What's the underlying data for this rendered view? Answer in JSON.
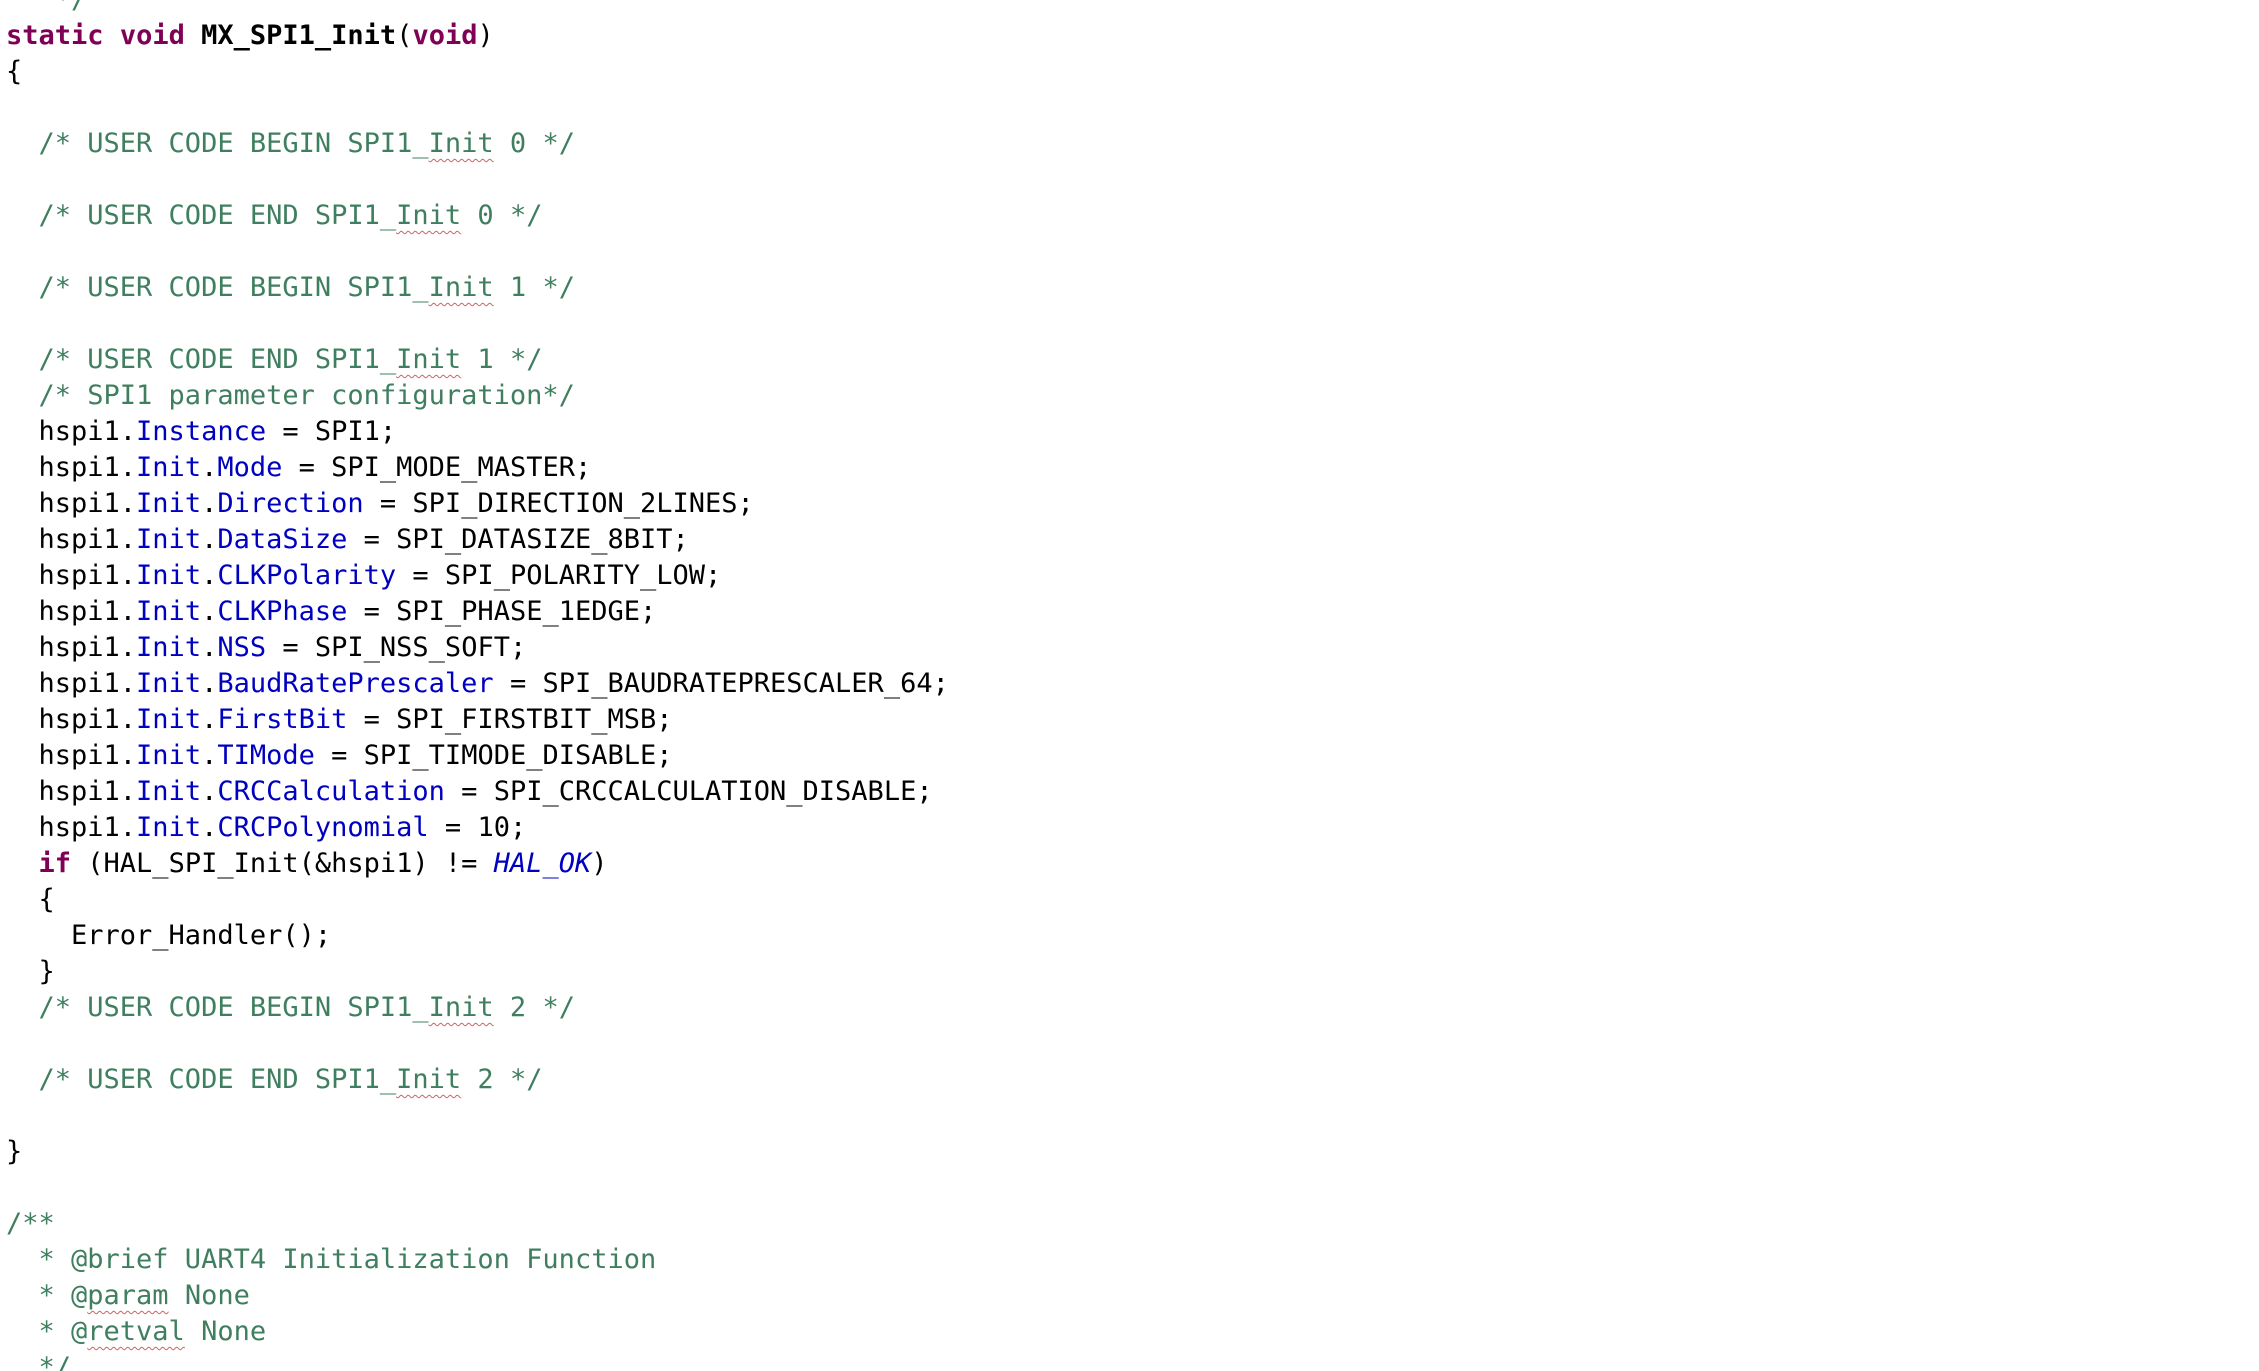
{
  "editor": {
    "lines": [
      {
        "segments": [
          {
            "t": "   */",
            "c": "cm"
          }
        ]
      },
      {
        "segments": [
          {
            "t": "static",
            "c": "kw"
          },
          {
            "t": " "
          },
          {
            "t": "void",
            "c": "kw"
          },
          {
            "t": " "
          },
          {
            "t": "MX_SPI1_Init",
            "c": "fn"
          },
          {
            "t": "("
          },
          {
            "t": "void",
            "c": "kw"
          },
          {
            "t": ")"
          }
        ]
      },
      {
        "segments": [
          {
            "t": "{"
          }
        ]
      },
      {
        "segments": []
      },
      {
        "segments": [
          {
            "t": "  /* USER CODE BEGIN SPI1_",
            "c": "cm"
          },
          {
            "t": "Init",
            "c": "cm sq"
          },
          {
            "t": " 0 */",
            "c": "cm"
          }
        ]
      },
      {
        "segments": []
      },
      {
        "segments": [
          {
            "t": "  /* USER CODE END SPI1_",
            "c": "cm"
          },
          {
            "t": "Init",
            "c": "cm sq"
          },
          {
            "t": " 0 */",
            "c": "cm"
          }
        ]
      },
      {
        "segments": []
      },
      {
        "segments": [
          {
            "t": "  /* USER CODE BEGIN SPI1_",
            "c": "cm"
          },
          {
            "t": "Init",
            "c": "cm sq"
          },
          {
            "t": " 1 */",
            "c": "cm"
          }
        ]
      },
      {
        "segments": []
      },
      {
        "segments": [
          {
            "t": "  /* USER CODE END SPI1_",
            "c": "cm"
          },
          {
            "t": "Init",
            "c": "cm sq"
          },
          {
            "t": " 1 */",
            "c": "cm"
          }
        ]
      },
      {
        "segments": [
          {
            "t": "  /* SPI1 parameter configuration*/",
            "c": "cm"
          }
        ]
      },
      {
        "segments": [
          {
            "t": "  hspi1."
          },
          {
            "t": "Instance",
            "c": "fld"
          },
          {
            "t": " = SPI1;"
          }
        ]
      },
      {
        "segments": [
          {
            "t": "  hspi1."
          },
          {
            "t": "Init",
            "c": "fld"
          },
          {
            "t": "."
          },
          {
            "t": "Mode",
            "c": "fld"
          },
          {
            "t": " = SPI_MODE_MASTER;"
          }
        ]
      },
      {
        "segments": [
          {
            "t": "  hspi1."
          },
          {
            "t": "Init",
            "c": "fld"
          },
          {
            "t": "."
          },
          {
            "t": "Direction",
            "c": "fld"
          },
          {
            "t": " = SPI_DIRECTION_2LINES;"
          }
        ]
      },
      {
        "segments": [
          {
            "t": "  hspi1."
          },
          {
            "t": "Init",
            "c": "fld"
          },
          {
            "t": "."
          },
          {
            "t": "DataSize",
            "c": "fld"
          },
          {
            "t": " = SPI_DATASIZE_8BIT;"
          }
        ]
      },
      {
        "segments": [
          {
            "t": "  hspi1."
          },
          {
            "t": "Init",
            "c": "fld"
          },
          {
            "t": "."
          },
          {
            "t": "CLKPolarity",
            "c": "fld"
          },
          {
            "t": " = SPI_POLARITY_LOW;"
          }
        ]
      },
      {
        "segments": [
          {
            "t": "  hspi1."
          },
          {
            "t": "Init",
            "c": "fld"
          },
          {
            "t": "."
          },
          {
            "t": "CLKPhase",
            "c": "fld"
          },
          {
            "t": " = SPI_PHASE_1EDGE;"
          }
        ]
      },
      {
        "segments": [
          {
            "t": "  hspi1."
          },
          {
            "t": "Init",
            "c": "fld"
          },
          {
            "t": "."
          },
          {
            "t": "NSS",
            "c": "fld"
          },
          {
            "t": " = SPI_NSS_SOFT;"
          }
        ]
      },
      {
        "segments": [
          {
            "t": "  hspi1."
          },
          {
            "t": "Init",
            "c": "fld"
          },
          {
            "t": "."
          },
          {
            "t": "BaudRatePrescaler",
            "c": "fld"
          },
          {
            "t": " = SPI_BAUDRATEPRESCALER_64;"
          }
        ]
      },
      {
        "segments": [
          {
            "t": "  hspi1."
          },
          {
            "t": "Init",
            "c": "fld"
          },
          {
            "t": "."
          },
          {
            "t": "FirstBit",
            "c": "fld"
          },
          {
            "t": " = SPI_FIRSTBIT_MSB;"
          }
        ]
      },
      {
        "segments": [
          {
            "t": "  hspi1."
          },
          {
            "t": "Init",
            "c": "fld"
          },
          {
            "t": "."
          },
          {
            "t": "TIMode",
            "c": "fld"
          },
          {
            "t": " = SPI_TIMODE_DISABLE;"
          }
        ]
      },
      {
        "segments": [
          {
            "t": "  hspi1."
          },
          {
            "t": "Init",
            "c": "fld"
          },
          {
            "t": "."
          },
          {
            "t": "CRCCalculation",
            "c": "fld"
          },
          {
            "t": " = SPI_CRCCALCULATION_DISABLE;"
          }
        ]
      },
      {
        "segments": [
          {
            "t": "  hspi1."
          },
          {
            "t": "Init",
            "c": "fld"
          },
          {
            "t": "."
          },
          {
            "t": "CRCPolynomial",
            "c": "fld"
          },
          {
            "t": " = 10;"
          }
        ]
      },
      {
        "segments": [
          {
            "t": "  "
          },
          {
            "t": "if",
            "c": "kw"
          },
          {
            "t": " (HAL_SPI_Init(&hspi1) != "
          },
          {
            "t": "HAL_OK",
            "c": "en"
          },
          {
            "t": ")"
          }
        ]
      },
      {
        "segments": [
          {
            "t": "  {"
          }
        ]
      },
      {
        "segments": [
          {
            "t": "    Error_Handler();"
          }
        ]
      },
      {
        "segments": [
          {
            "t": "  }"
          }
        ]
      },
      {
        "segments": [
          {
            "t": "  /* USER CODE BEGIN SPI1_",
            "c": "cm"
          },
          {
            "t": "Init",
            "c": "cm sq"
          },
          {
            "t": " 2 */",
            "c": "cm"
          }
        ]
      },
      {
        "segments": []
      },
      {
        "segments": [
          {
            "t": "  /* USER CODE END SPI1_",
            "c": "cm"
          },
          {
            "t": "Init",
            "c": "cm sq"
          },
          {
            "t": " 2 */",
            "c": "cm"
          }
        ]
      },
      {
        "segments": []
      },
      {
        "segments": [
          {
            "t": "}"
          }
        ]
      },
      {
        "segments": []
      },
      {
        "segments": [
          {
            "t": "/**",
            "c": "cm"
          }
        ]
      },
      {
        "segments": [
          {
            "t": "  * @brief UART4 Initialization Function",
            "c": "cm"
          }
        ]
      },
      {
        "segments": [
          {
            "t": "  * @",
            "c": "cm"
          },
          {
            "t": "param",
            "c": "cm sq"
          },
          {
            "t": " None",
            "c": "cm"
          }
        ]
      },
      {
        "segments": [
          {
            "t": "  * @",
            "c": "cm"
          },
          {
            "t": "retval",
            "c": "cm sq"
          },
          {
            "t": " None",
            "c": "cm"
          }
        ]
      },
      {
        "segments": [
          {
            "t": "  */",
            "c": "cm"
          }
        ]
      }
    ]
  }
}
